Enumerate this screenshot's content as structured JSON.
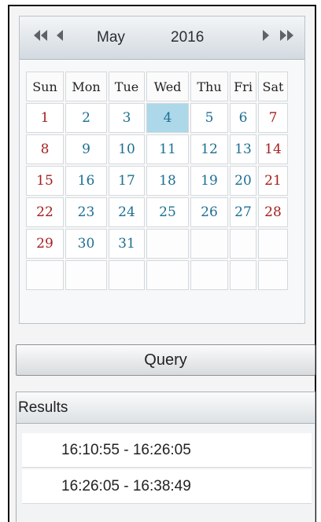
{
  "calendar": {
    "month": "May",
    "year": "2016",
    "weekdays": [
      "Sun",
      "Mon",
      "Tue",
      "Wed",
      "Thu",
      "Fri",
      "Sat"
    ],
    "selected_day": "4",
    "weeks": [
      [
        "1",
        "2",
        "3",
        "4",
        "5",
        "6",
        "7"
      ],
      [
        "8",
        "9",
        "10",
        "11",
        "12",
        "13",
        "14"
      ],
      [
        "15",
        "16",
        "17",
        "18",
        "19",
        "20",
        "21"
      ],
      [
        "22",
        "23",
        "24",
        "25",
        "26",
        "27",
        "28"
      ],
      [
        "29",
        "30",
        "31",
        "",
        "",
        "",
        ""
      ],
      [
        "",
        "",
        "",
        "",
        "",
        "",
        ""
      ]
    ],
    "nav_icons": {
      "prev_year": "double-left-arrow-icon",
      "prev_month": "left-arrow-icon",
      "next_month": "right-arrow-icon",
      "next_year": "double-right-arrow-icon"
    }
  },
  "query": {
    "label": "Query"
  },
  "results": {
    "title": "Results",
    "items": [
      "16:10:55 - 16:26:05",
      "16:26:05 - 16:38:49"
    ]
  },
  "colors": {
    "weekday_text": "#1d6f93",
    "weekend_text": "#a5201f",
    "selected_bg": "#add8ea",
    "frame": "#111111"
  }
}
